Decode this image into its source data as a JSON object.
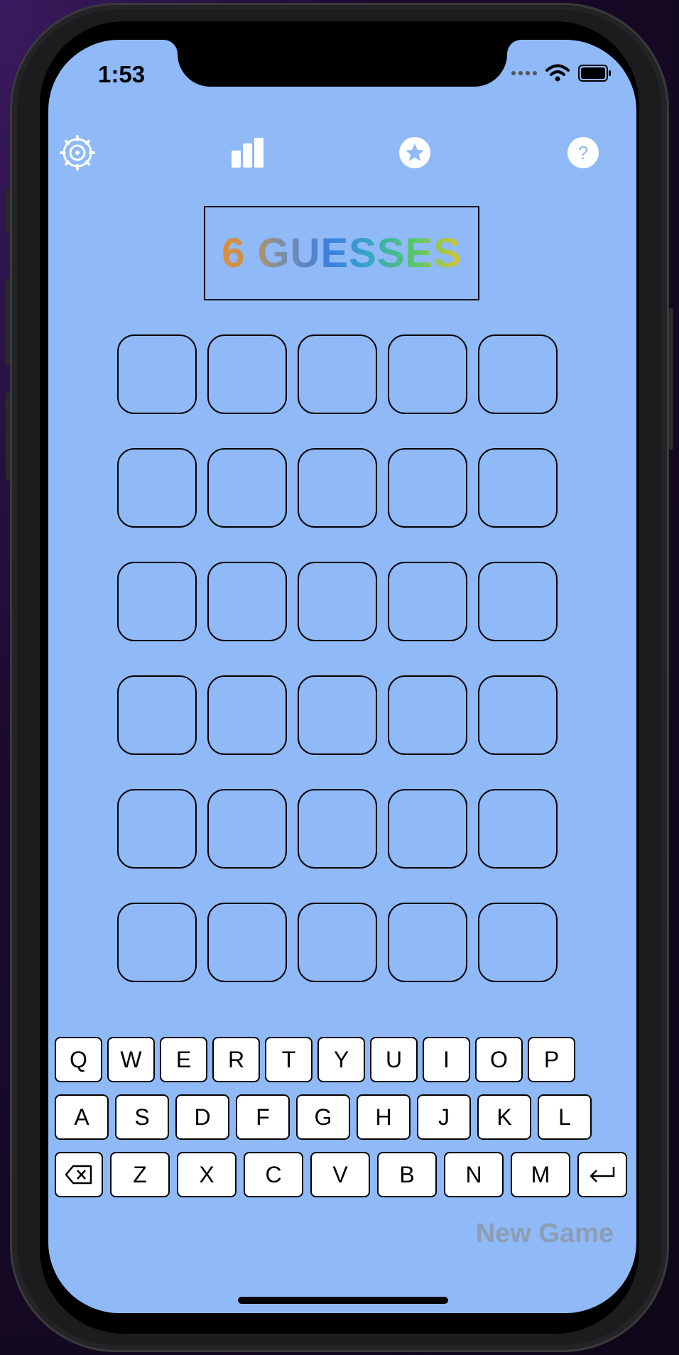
{
  "status_bar": {
    "time": "1:53"
  },
  "toolbar": {
    "icons": [
      "settings-gear-icon",
      "stats-bar-chart-icon",
      "star-icon",
      "help-question-icon"
    ],
    "help_glyph": "?"
  },
  "title": "6 GUESSES",
  "board": {
    "rows": 6,
    "columns": 5
  },
  "keyboard": {
    "row1": [
      "Q",
      "W",
      "E",
      "R",
      "T",
      "Y",
      "U",
      "I",
      "O",
      "P"
    ],
    "row2": [
      "A",
      "S",
      "D",
      "F",
      "G",
      "H",
      "J",
      "K",
      "L"
    ],
    "row3": [
      "Z",
      "X",
      "C",
      "V",
      "B",
      "N",
      "M"
    ],
    "backspace_icon": "backspace-icon",
    "enter_icon": "return-icon"
  },
  "new_game_label": "New Game",
  "colors": {
    "background": "#8fb9f7",
    "title_gradient": [
      "#e08c35",
      "#7a8fa6",
      "#3d7fe0",
      "#54c864",
      "#d8c43a"
    ],
    "new_game_text": "#8d9db4"
  }
}
